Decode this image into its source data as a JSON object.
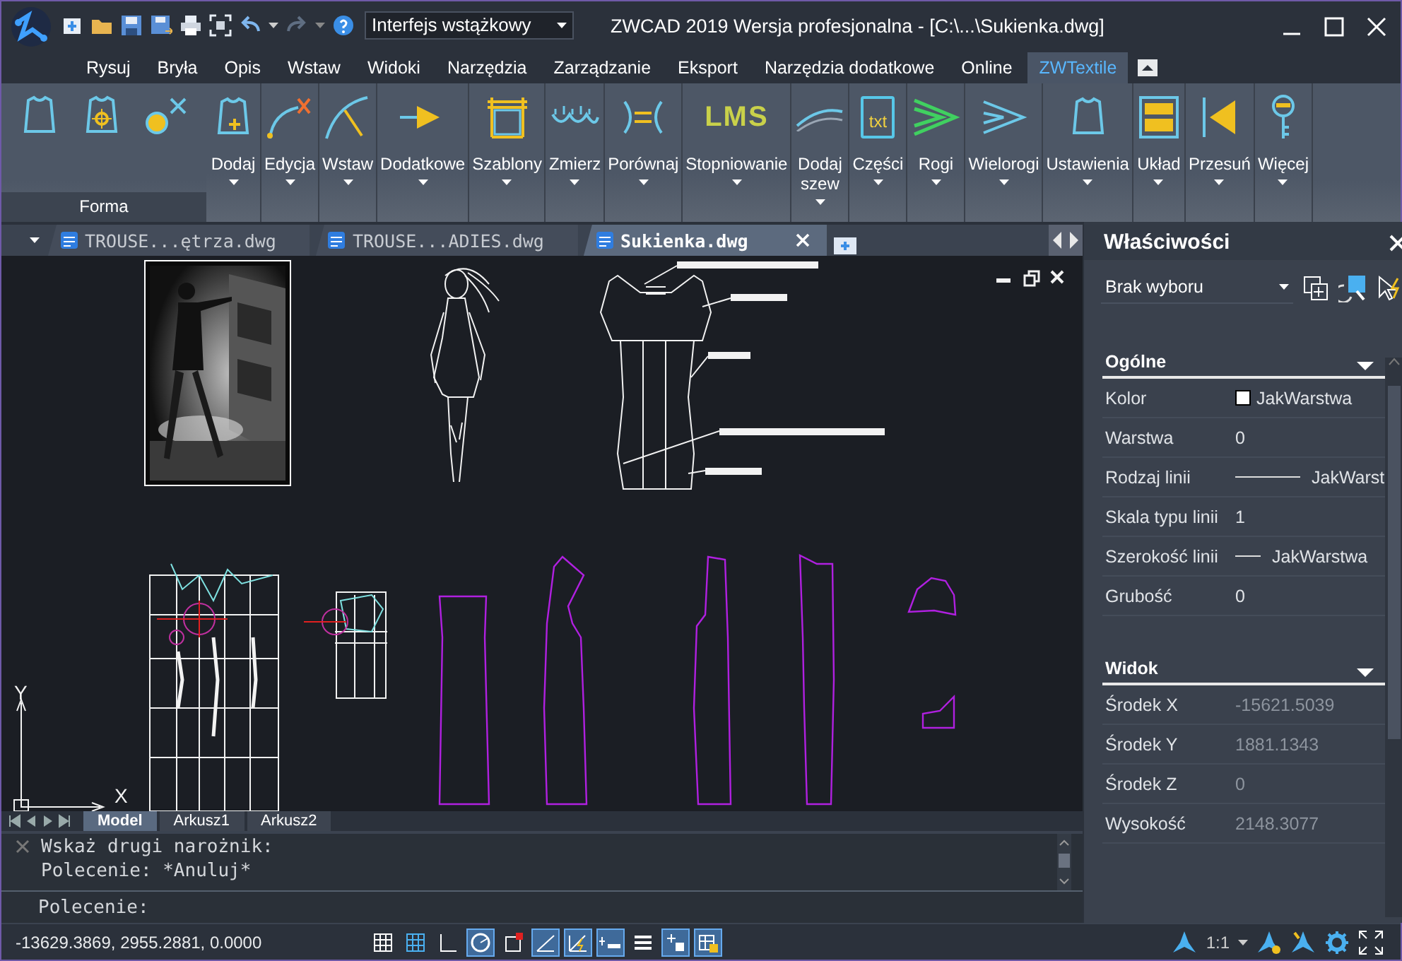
{
  "title_bar": {
    "workspace": "Interfejs wstążkowy",
    "title": "ZWCAD 2019 Wersja profesjonalna - [C:\\...\\Sukienka.dwg]"
  },
  "ribbon_tabs": [
    {
      "label": "Rysuj",
      "selected": false
    },
    {
      "label": "Bryła",
      "selected": false
    },
    {
      "label": "Opis",
      "selected": false
    },
    {
      "label": "Wstaw",
      "selected": false
    },
    {
      "label": "Widoki",
      "selected": false
    },
    {
      "label": "Narzędzia",
      "selected": false
    },
    {
      "label": "Zarządzanie",
      "selected": false
    },
    {
      "label": "Eksport",
      "selected": false
    },
    {
      "label": "Narzędzia dodatkowe",
      "selected": false
    },
    {
      "label": "Online",
      "selected": false
    },
    {
      "label": "ZWTextile",
      "selected": true
    }
  ],
  "ribbon": {
    "panel_title": "Forma",
    "tools": [
      {
        "label": "Dodaj"
      },
      {
        "label": "Edycja"
      },
      {
        "label": "Wstaw"
      },
      {
        "label": "Dodatkowe"
      },
      {
        "label": "Szablony"
      },
      {
        "label": "Zmierz"
      },
      {
        "label": "Porównaj"
      },
      {
        "label": "Stopniowanie",
        "icon_text": "LMS"
      },
      {
        "label": "Dodaj\nszew"
      },
      {
        "label": "Części",
        "icon_text": "txt"
      },
      {
        "label": "Rogi"
      },
      {
        "label": "Wielorogi"
      },
      {
        "label": "Ustawienia"
      },
      {
        "label": "Układ"
      },
      {
        "label": "Przesuń"
      },
      {
        "label": "Więcej"
      }
    ]
  },
  "document_tabs": [
    {
      "label": "TROUSE...ętrza.dwg",
      "selected": false
    },
    {
      "label": "TROUSE...ADIES.dwg",
      "selected": false
    },
    {
      "label": "Sukienka.dwg",
      "selected": true
    }
  ],
  "drawing": {
    "axis_x": "X",
    "axis_y": "Y"
  },
  "layout_tabs": [
    {
      "label": "Model",
      "selected": true
    },
    {
      "label": "Arkusz1",
      "selected": false
    },
    {
      "label": "Arkusz2",
      "selected": false
    }
  ],
  "command": {
    "history": [
      "Wskaż drugi narożnik:",
      "Polecenie: *Anuluj*"
    ],
    "prompt": "Polecenie:"
  },
  "properties": {
    "title": "Właściwości",
    "selection": "Brak wyboru",
    "sections": [
      {
        "title": "Ogólne",
        "expanded": true,
        "rows": [
          {
            "label": "Kolor",
            "value": "JakWarstwa",
            "kind": "color",
            "disabled": false
          },
          {
            "label": "Warstwa",
            "value": "0",
            "kind": "text",
            "disabled": false
          },
          {
            "label": "Rodzaj linii",
            "value": "JakWarst",
            "kind": "line",
            "disabled": false
          },
          {
            "label": "Skala typu linii",
            "value": "1",
            "kind": "text",
            "disabled": false
          },
          {
            "label": "Szerokość linii",
            "value": "JakWarstwa",
            "kind": "short-line",
            "disabled": false
          },
          {
            "label": "Grubość",
            "value": "0",
            "kind": "text",
            "disabled": false
          }
        ]
      },
      {
        "title": "Widok",
        "expanded": true,
        "rows": [
          {
            "label": "Środek X",
            "value": "-15621.5039",
            "kind": "text",
            "disabled": true
          },
          {
            "label": "Środek Y",
            "value": "1881.1343",
            "kind": "text",
            "disabled": true
          },
          {
            "label": "Środek Z",
            "value": "0",
            "kind": "text",
            "disabled": true
          },
          {
            "label": "Wysokość",
            "value": "2148.3077",
            "kind": "text",
            "disabled": true
          }
        ]
      }
    ]
  },
  "status_bar": {
    "coordinates": "-13629.3869, 2955.2881, 0.0000",
    "toggles": [
      {
        "on": false
      },
      {
        "on": false
      },
      {
        "on": false
      },
      {
        "on": true
      },
      {
        "on": false
      },
      {
        "on": true
      },
      {
        "on": true
      },
      {
        "on": true
      },
      {
        "on": false
      },
      {
        "on": true
      },
      {
        "on": true
      }
    ],
    "scale": "1:1"
  }
}
